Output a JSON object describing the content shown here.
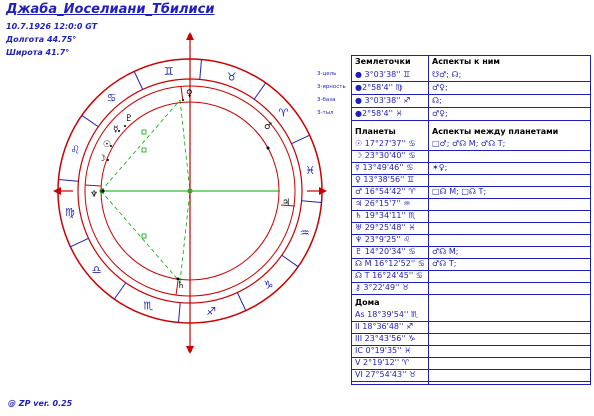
{
  "header": {
    "title": "Джаба_Иоселиани_Тбилиси",
    "datetime": "10.7.1926 12:0:0 GT",
    "longitude": "Долгота 44.75°",
    "latitude": "Широта 41.7°"
  },
  "footer": "@ ZP  ver. 0.25",
  "side_labels": [
    "3-цель",
    "3-ярность",
    "3-база",
    "3-тыл"
  ],
  "zodiac_glyphs": [
    "♉",
    "♈",
    "♓",
    "♒",
    "♑",
    "♐",
    "♏",
    "♎",
    "♍",
    "♌",
    "♋",
    "♊"
  ],
  "earth_points": {
    "header": "Землеточки",
    "aspects_header": "Аспекты к ним",
    "rows": [
      {
        "point": "● 3°03'38'' ♊",
        "aspects": "☋♂; ☊;"
      },
      {
        "point": "●2°58'4'' ♍",
        "aspects": "♂♀;"
      },
      {
        "point": "● 3°03'38'' ♐",
        "aspects": "☊;"
      },
      {
        "point": "●2°58'4'' ♓",
        "aspects": "♂♀;"
      }
    ]
  },
  "planets": {
    "header": "Планеты",
    "aspects_header": "Аспекты между планетами",
    "rows": [
      {
        "planet": "☉ 17°27'37'' ♋",
        "aspects": "□♂; ♂☊ M; ♂☊ T;"
      },
      {
        "planet": "☽ 23°30'40'' ♋",
        "aspects": ""
      },
      {
        "planet": "☿ 13°49'46'' ♋",
        "aspects": "✶♀;"
      },
      {
        "planet": "♀ 13°38'56'' ♊",
        "aspects": ""
      },
      {
        "planet": "♂ 16°54'42'' ♈",
        "aspects": "□☊ M; □☊ T;"
      },
      {
        "planet": "♃ 26°15'7'' ♒",
        "aspects": ""
      },
      {
        "planet": "♄ 19°34'11'' ♏",
        "aspects": ""
      },
      {
        "planet": "♅ 29°25'48'' ♓",
        "aspects": ""
      },
      {
        "planet": "♆ 23°9'25'' ♌",
        "aspects": ""
      },
      {
        "planet": "♇ 14°20'34'' ♋",
        "aspects": "♂☊ M;"
      },
      {
        "planet": "☊ M 16°12'52'' ♋",
        "aspects": "♂☊ T;"
      },
      {
        "planet": "☊ T 16°24'45'' ♋",
        "aspects": ""
      },
      {
        "planet": "⚷ 3°22'49'' ♉",
        "aspects": ""
      }
    ]
  },
  "houses": {
    "header": "Дома",
    "rows": [
      "As 18°39'54'' ♏",
      "II 18°36'48'' ♐",
      "III 23°43'56'' ♑",
      "IC 0°19'35'' ♓",
      "V 2°19'12'' ♈",
      "VI 27°54'43'' ♉"
    ]
  }
}
